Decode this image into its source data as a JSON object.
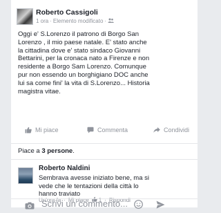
{
  "post": {
    "author": "Roberto Cassigoli",
    "time": "1 ora",
    "edited": "Elemento modificato",
    "audience_icon": "friends-icon",
    "text": "Oggi e' S.Lorenzo il patrono di Borgo San\nLorenzo , il mio paese natale.  E' stato anche\nla cittadina dove e' stato sindaco Giovanni\nBettarini, per la cronaca  nato a Firenze e non\nresidente a Borgo Sam Lorenzo.  Comunque\npur non essendo un borghigiano DOC  anche\nlui sa come fini' la vita di S.Lorenzo...  Historia\nmagistra vitae."
  },
  "actions": {
    "like": "Mi piace",
    "comment": "Commenta",
    "share": "Condividi"
  },
  "likes": {
    "prefix": "Piace a ",
    "count": "3 persone",
    "suffix": "."
  },
  "comment": {
    "author": "Roberto Naldini",
    "text": "Sembrava avesse iniziato bene, ma si\nvede che le tentazioni della città lo\nhanno traviato",
    "time": "Un'ora fa",
    "like": "Mi piace",
    "like_count": "1",
    "reply": "Rispondi"
  },
  "composer": {
    "placeholder": "Scrivi un commento..."
  },
  "colors": {
    "background": "#e9ebee",
    "card": "#ffffff",
    "secondary_text": "#90949c",
    "accent": "#4267b2"
  }
}
